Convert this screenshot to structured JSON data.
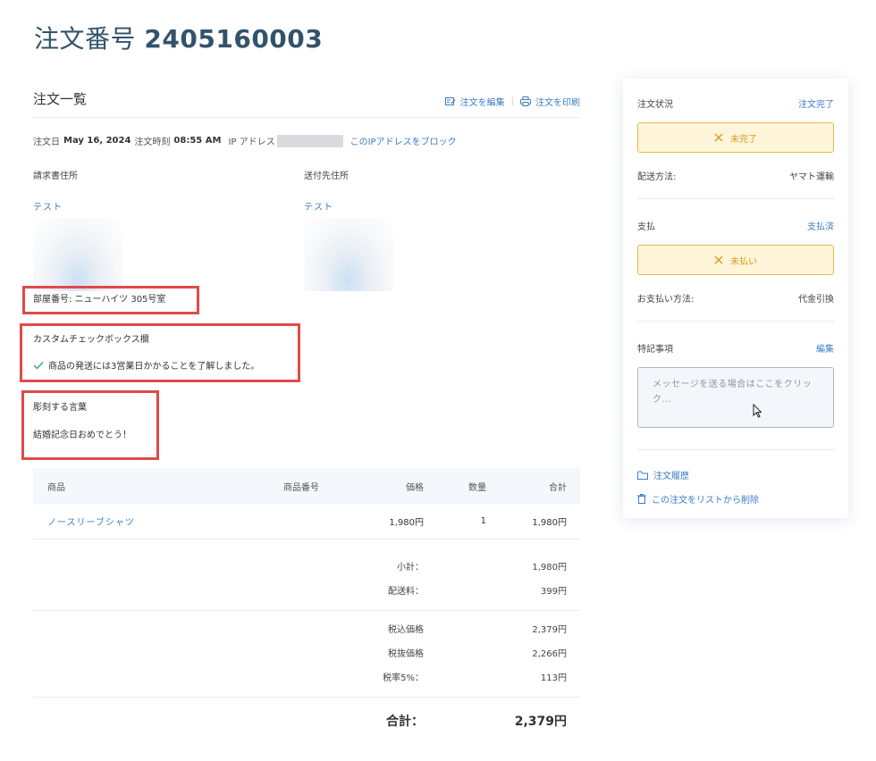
{
  "page": {
    "title_prefix": "注文番号",
    "order_number": "2405160003"
  },
  "order_list": {
    "title": "注文一覧",
    "edit_label": "注文を編集",
    "print_label": "注文を印刷",
    "meta": {
      "date_label": "注文日",
      "date": "May 16, 2024",
      "time_label": "注文時刻",
      "time": "08:55 AM",
      "ip_label": "IP アドレス",
      "block_ip": "このIPアドレスをブロック"
    },
    "billing": {
      "label": "請求書住所",
      "name": "テスト"
    },
    "shipping": {
      "label": "送付先住所",
      "name": "テスト"
    },
    "room": "部屋番号: ニューハイツ 305号室",
    "custom_checkbox_label": "カスタムチェックボックス欄",
    "custom_checkbox_value": "商品の発送には3営業日かかることを了解しました。",
    "engrave_label": "彫刻する言葉",
    "engrave_value": "結婚記念日おめでとう！"
  },
  "table": {
    "headers": {
      "product": "商品",
      "sku": "商品番号",
      "price": "価格",
      "qty": "数量",
      "total": "合計"
    },
    "rows": [
      {
        "product": "ノースリーブシャツ",
        "sku": "",
        "price": "1,980円",
        "qty": "1",
        "total": "1,980円"
      }
    ]
  },
  "totals": {
    "subtotal_label": "小計：",
    "subtotal": "1,980円",
    "shipping_label": "配送料：",
    "shipping": "399円",
    "incl_tax_label": "税込価格",
    "incl_tax": "2,379円",
    "excl_tax_label": "税抜価格",
    "excl_tax": "2,266円",
    "tax_rate_label": "税率5%：",
    "tax": "113円",
    "grand_label": "合計：",
    "grand": "2,379円"
  },
  "sidebar": {
    "order_status_label": "注文状況",
    "order_status_link": "注文完了",
    "fulfillment_status": "未完了",
    "shipping_method_label": "配送方法:",
    "shipping_method": "ヤマト運輸",
    "payment_label": "支払",
    "payment_link": "支払済",
    "payment_status": "未払い",
    "payment_method_label": "お支払い方法:",
    "payment_method": "代金引換",
    "notes_label": "特記事項",
    "notes_edit": "編集",
    "notes_placeholder": "メッセージを送る場合はここをクリック...",
    "history_link": "注文履歴",
    "delete_link": "この注文をリストから削除"
  },
  "colors": {
    "accent": "#3b7dc4",
    "warning_bg": "#fff5d9",
    "warning_border": "#e8b84a",
    "highlight": "#e04a4a"
  }
}
